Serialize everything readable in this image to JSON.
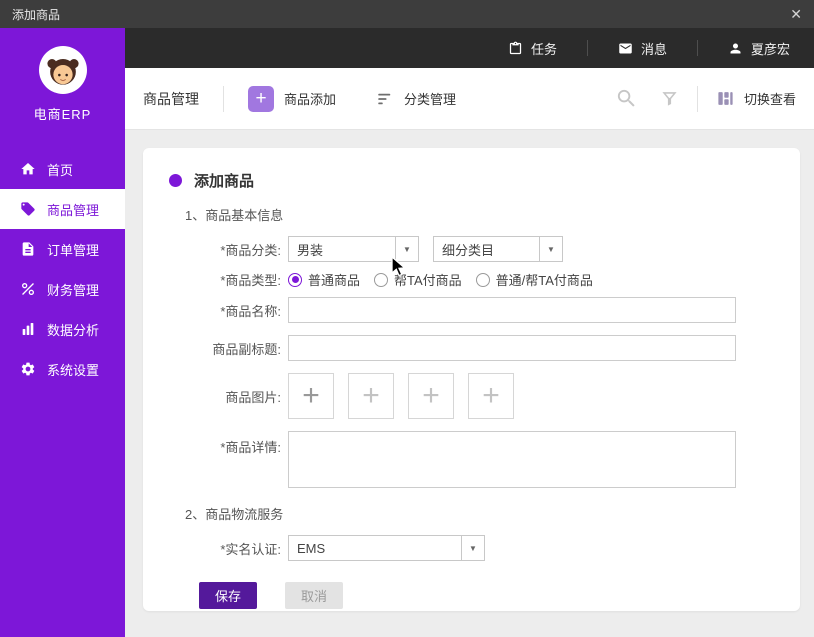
{
  "window": {
    "title": "添加商品"
  },
  "icons": {
    "close": "✕",
    "dropdown": "▼",
    "plus": "+"
  },
  "header": {
    "tasks": "任务",
    "messages": "消息",
    "user": "夏彦宏"
  },
  "sidebar": {
    "brand": "电商ERP",
    "items": [
      {
        "label": "首页"
      },
      {
        "label": "商品管理"
      },
      {
        "label": "订单管理"
      },
      {
        "label": "财务管理"
      },
      {
        "label": "数据分析"
      },
      {
        "label": "系统设置"
      }
    ]
  },
  "toolbar": {
    "title": "商品管理",
    "add": "商品添加",
    "category": "分类管理",
    "switch_view": "切换查看"
  },
  "form": {
    "title": "添加商品",
    "section1": "1、商品基本信息",
    "category_label": "*商品分类:",
    "category_value": "男装",
    "subcategory_value": "细分类目",
    "type_label": "*商品类型:",
    "type_options": [
      "普通商品",
      "帮TA付商品",
      "普通/帮TA付商品"
    ],
    "type_selected": "普通商品",
    "name_label": "*商品名称:",
    "subtitle_label": "商品副标题:",
    "images_label": "商品图片:",
    "detail_label": "*商品详情:",
    "section2": "2、商品物流服务",
    "realname_label": "*实名认证:",
    "realname_value": "EMS",
    "save": "保存",
    "cancel": "取消"
  },
  "colors": {
    "sidebar_purple": "#7d17d8",
    "accent_purple": "#7d17d8",
    "save_button_purple": "#54199b",
    "toolbar_plus_purple": "#a177e0",
    "header_dark": "#2b2b2b",
    "titlebar_dark": "#3d3d3d"
  }
}
